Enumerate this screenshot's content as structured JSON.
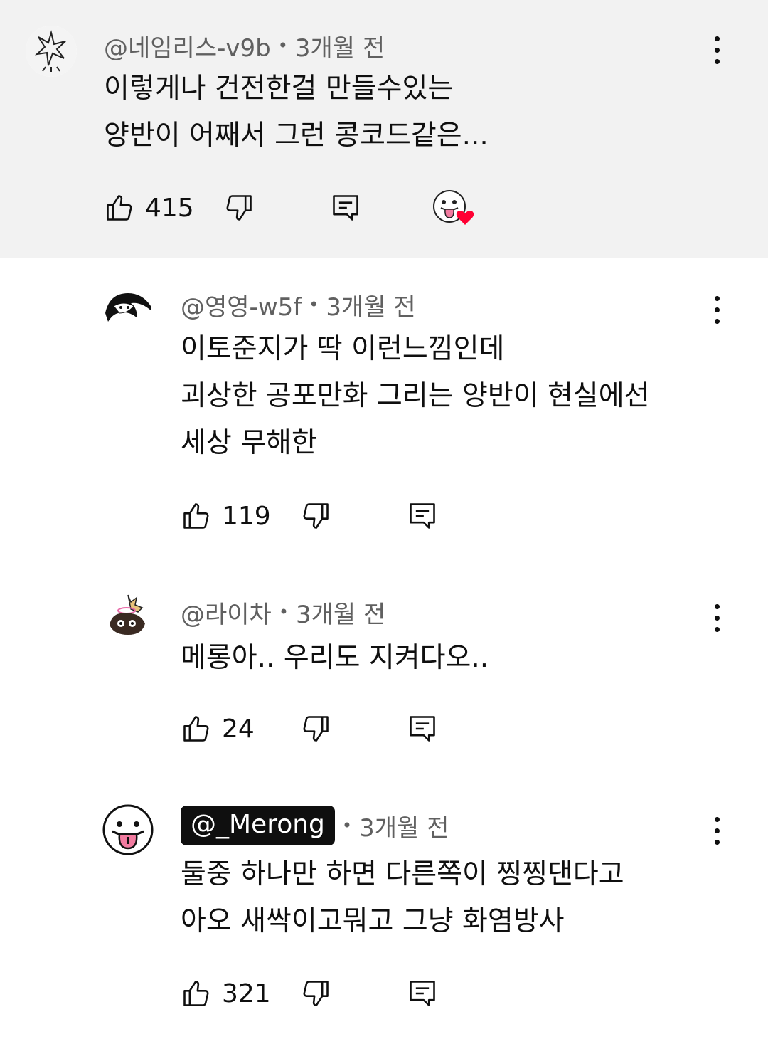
{
  "comments": [
    {
      "handle": "@네임리스-v9b",
      "time": "3개월 전",
      "lines": [
        "이렇게나 건전한걸 만들수있는",
        "양반이 어째서 그런 콩코드같은..."
      ],
      "likes": "415",
      "creator_hearted": true,
      "highlighted": true
    },
    {
      "handle": "@영영-w5f",
      "time": "3개월 전",
      "lines": [
        "이토준지가 딱 이런느낌인데",
        "괴상한 공포만화 그리는 양반이 현실에선",
        "세상 무해한"
      ],
      "likes": "119"
    },
    {
      "handle": "@라이차",
      "time": "3개월 전",
      "lines": [
        "메롱아.. 우리도 지켜다오.."
      ],
      "likes": "24"
    },
    {
      "handle": "@_Merong",
      "time": "3개월 전",
      "lines": [
        "둘중 하나만 하면 다른쪽이 찡찡댄다고",
        "아오 새싹이고뭐고 그냥 화염방사"
      ],
      "likes": "321",
      "is_creator": true
    }
  ],
  "separator": "•",
  "colors": {
    "highlight_bg": "#f2f2f2",
    "meta_text": "#606060",
    "heart": "#ff0033",
    "tongue": "#f27ba0"
  }
}
